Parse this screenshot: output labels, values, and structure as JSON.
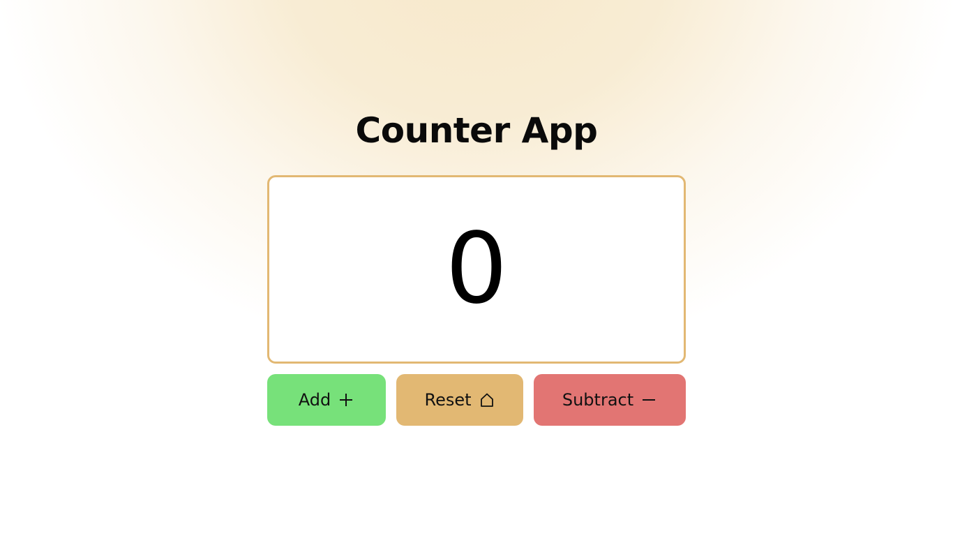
{
  "app": {
    "title": "Counter App"
  },
  "counter": {
    "value": "0"
  },
  "buttons": {
    "add": {
      "label": "Add",
      "icon": "plus-icon",
      "color": "#77e17a"
    },
    "reset": {
      "label": "Reset",
      "icon": "home-icon",
      "color": "#e2b873"
    },
    "subtract": {
      "label": "Subtract",
      "icon": "minus-icon",
      "color": "#e27573"
    }
  },
  "theme": {
    "accent": "#e2b873",
    "background_glow": "#f3e3c4"
  }
}
